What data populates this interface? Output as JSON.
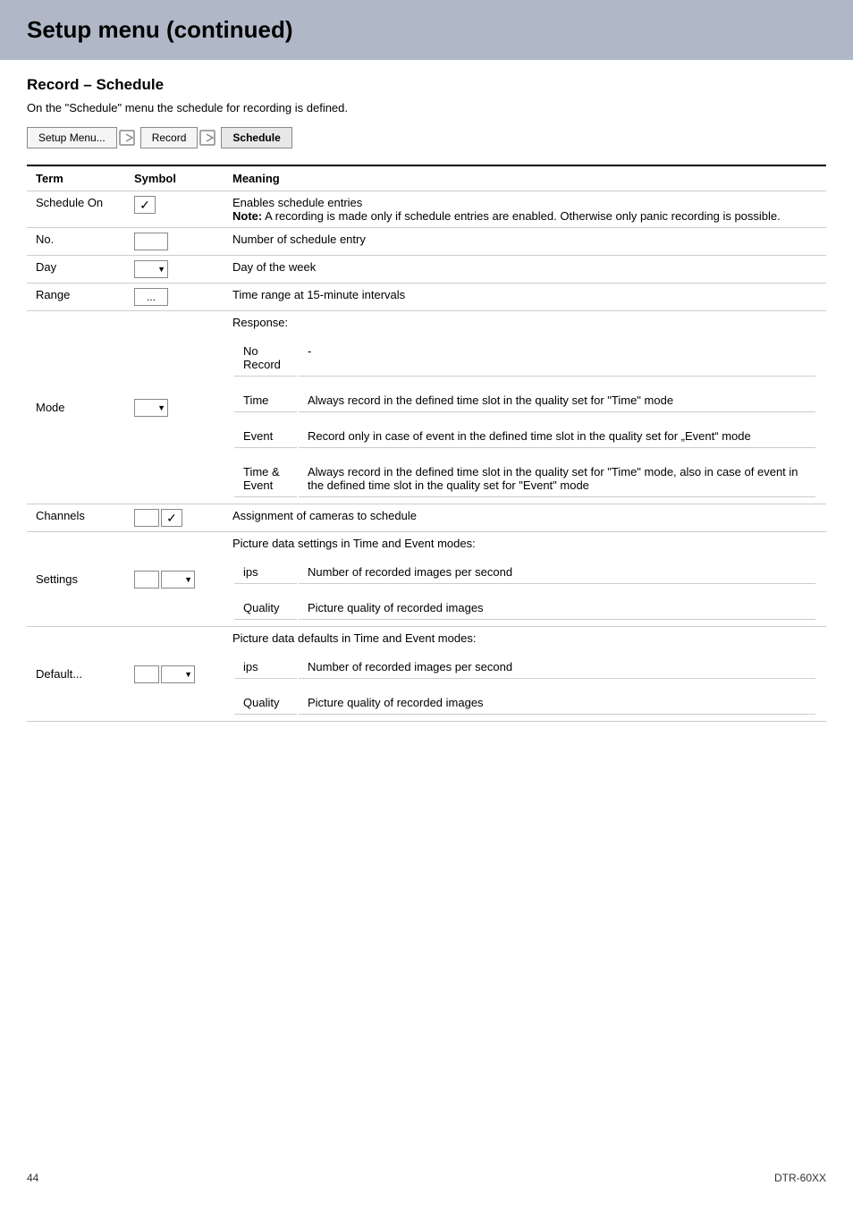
{
  "header": {
    "title": "Setup menu (continued)"
  },
  "section": {
    "title": "Record – Schedule",
    "intro": "On the \"Schedule\" menu the schedule for recording is defined."
  },
  "breadcrumb": {
    "items": [
      {
        "label": "Setup Menu...",
        "active": false
      },
      {
        "label": "Record",
        "active": false
      },
      {
        "label": "Schedule",
        "active": true
      }
    ]
  },
  "table": {
    "headers": [
      "Term",
      "Symbol",
      "Meaning"
    ],
    "rows": [
      {
        "term": "Schedule On",
        "symbol": "checkbox",
        "meanings": [
          {
            "text": "Enables schedule entries",
            "bold": false
          },
          {
            "text": "Note:",
            "bold": true,
            "suffix": " A recording is made only if schedule entries are enabled. Otherwise only panic recording is possible."
          }
        ]
      },
      {
        "term": "No.",
        "symbol": "box",
        "meaning": "Number of schedule entry"
      },
      {
        "term": "Day",
        "symbol": "dropdown",
        "meaning": "Day of the week"
      },
      {
        "term": "Range",
        "symbol": "ellipsis",
        "meaning": "Time range at 15-minute intervals"
      },
      {
        "term": "Mode",
        "symbol": "dropdown",
        "meanings_sub": [
          {
            "label": "Response:",
            "desc": ""
          },
          {
            "label": "No Record",
            "desc": "-"
          },
          {
            "label": "Time",
            "desc": "Always record in the defined time slot in the quality set for \"Time\" mode"
          },
          {
            "label": "Event",
            "desc": "Record only in case of event in the defined time slot in the quality set for „Event“ mode"
          },
          {
            "label": "Time &\nEvent",
            "desc": "Always record in the defined time slot in the quality set for \"Time\" mode, also in case of event in the defined time slot in the quality set for \"Event\" mode"
          }
        ]
      },
      {
        "term": "Channels",
        "symbol": "box-check",
        "meaning": "Assignment of cameras to schedule"
      },
      {
        "term": "Settings",
        "symbol": "box-dropdown",
        "meanings_settings": [
          {
            "header": "Picture data settings in Time and Event modes:",
            "items": [
              {
                "label": "ips",
                "desc": "Number of recorded images per second"
              },
              {
                "label": "Quality",
                "desc": "Picture quality of recorded images"
              }
            ]
          }
        ]
      },
      {
        "term": "Default...",
        "symbol": "box-dropdown",
        "meanings_default": [
          {
            "header": "Picture data defaults in Time and Event modes:",
            "items": [
              {
                "label": "ips",
                "desc": "Number of recorded images per second"
              },
              {
                "label": "Quality",
                "desc": "Picture quality of recorded images"
              }
            ]
          }
        ]
      }
    ]
  },
  "footer": {
    "page_number": "44",
    "product": "DTR-60XX"
  }
}
